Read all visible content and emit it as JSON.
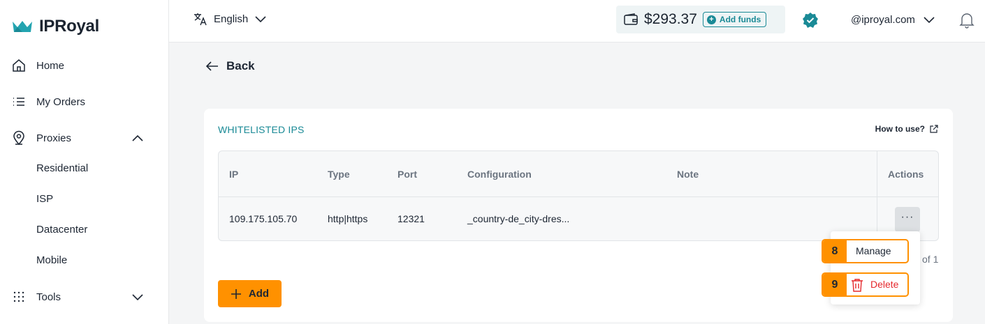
{
  "brand": {
    "name": "IPRoyal",
    "accent": "#1a8a96",
    "orange": "#ff9100",
    "danger": "#e5282c"
  },
  "sidebar": {
    "items": [
      {
        "label": "Home",
        "icon": "home-icon"
      },
      {
        "label": "My Orders",
        "icon": "list-icon"
      },
      {
        "label": "Proxies",
        "icon": "location-pin-icon"
      },
      {
        "label": "Tools",
        "icon": "grid-dots-icon"
      }
    ],
    "proxies_sub": [
      "Residential",
      "ISP",
      "Datacenter",
      "Mobile"
    ]
  },
  "topbar": {
    "language": "English",
    "balance": "$293.37",
    "add_funds": "Add funds",
    "account": "@iproyal.com"
  },
  "page": {
    "back": "Back",
    "section_title": "WHITELISTED IPS",
    "how_to_use": "How to use?",
    "add_button": "Add",
    "pagination_suffix": "of 1"
  },
  "table": {
    "headers": [
      "IP",
      "Type",
      "Port",
      "Configuration",
      "Note",
      "Actions"
    ],
    "rows": [
      {
        "ip": "109.175.105.70",
        "type": "http|https",
        "port": "12321",
        "configuration": "_country-de_city-dres...",
        "note": ""
      }
    ],
    "actions_button": "···"
  },
  "menu": {
    "items": [
      {
        "badge": "8",
        "label": "Manage"
      },
      {
        "badge": "9",
        "label": "Delete"
      }
    ]
  }
}
